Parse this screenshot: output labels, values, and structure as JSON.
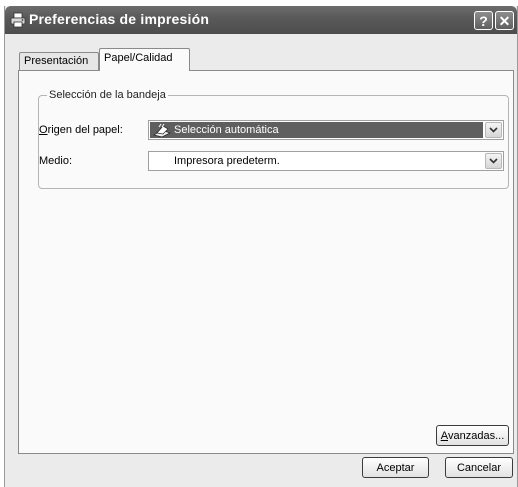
{
  "window": {
    "title": "Preferencias de impresión",
    "icon": "printer-icon",
    "help_symbol": "?",
    "close_symbol": "✕"
  },
  "tabs": [
    {
      "label": "Presentación",
      "selected": false
    },
    {
      "label": "Papel/Calidad",
      "selected": true
    }
  ],
  "tray_group": {
    "legend": "Selección de la bandeja",
    "paper_source": {
      "label_mnemonic": "O",
      "label_rest": "rigen del papel:",
      "value": "Selección automática",
      "icon": "paper-tray-icon"
    },
    "media": {
      "label": "Medio:",
      "value": "Impresora predeterm."
    }
  },
  "buttons": {
    "advanced_mnemonic": "A",
    "advanced_rest": "vanzadas...",
    "ok": "Aceptar",
    "cancel": "Cancelar"
  },
  "colors": {
    "titlebar": "#5a5a5a",
    "selected_combo": "#5f5f5f",
    "panel": "#fafafa"
  }
}
